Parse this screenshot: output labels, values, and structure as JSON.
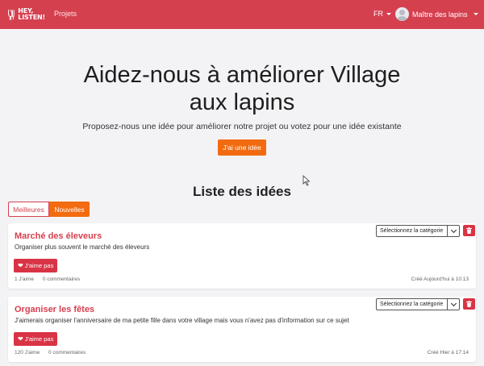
{
  "navbar": {
    "logo_line1": "HEY,",
    "logo_line2": "LISTEN!",
    "projects": "Projets",
    "language": "FR",
    "user_name": "Maître des lapins",
    "bg_color": "#d5404f"
  },
  "hero": {
    "title": "Aidez-nous à améliorer Village aux lapins",
    "subtitle": "Proposez-nous une idée pour améliorer notre projet ou votez pour une idée existante",
    "idea_button": "J'ai une idée",
    "accent_color": "#f36b10"
  },
  "list": {
    "title": "Liste des idées",
    "tabs": [
      {
        "label": "Meilleures",
        "active": false
      },
      {
        "label": "Nouvelles",
        "active": true
      }
    ]
  },
  "ideas": [
    {
      "title": "Marché des éleveurs",
      "description": "Organiser plus souvent le marché des éleveurs",
      "dislike_label": "J'aime pas",
      "likes": "1 J'aime",
      "comments": "0 commentaires",
      "created": "Créé Aujourd'hui à 10:13",
      "category_select": "Sélectionnez la catégorie"
    },
    {
      "title": "Organiser les fêtes",
      "description": "J'aimerais organiser l'anniversaire de ma petite fille dans votre village mais vous n'avez pas d'information sur ce sujet",
      "dislike_label": "J'aime pas",
      "likes": "120 J'aime",
      "comments": "0 commentaires",
      "created": "Créé Hier à 17:14",
      "category_select": "Sélectionnez la catégorie"
    }
  ],
  "icons": [
    "logo-icon",
    "chevron-down-icon",
    "avatar-icon",
    "broken-heart-icon",
    "trash-icon",
    "mouse-cursor-icon"
  ]
}
